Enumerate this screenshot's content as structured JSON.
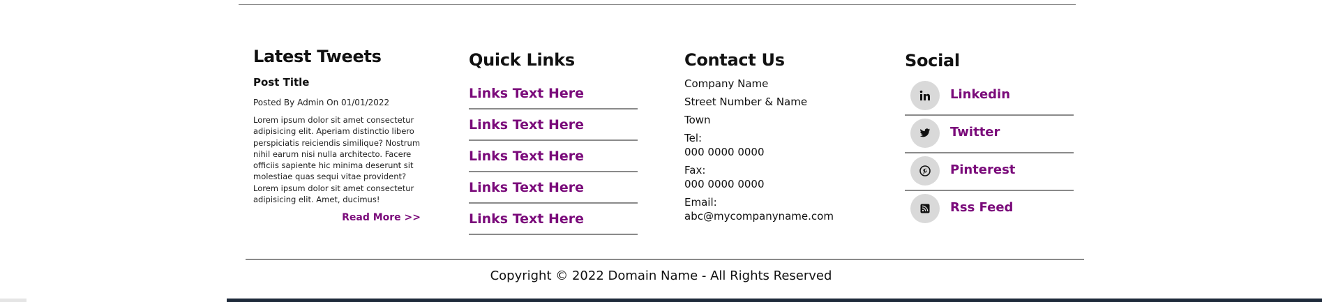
{
  "tweets": {
    "heading": "Latest Tweets",
    "post_title": "Post Title",
    "posted": "Posted By Admin On 01/01/2022",
    "body": "Lorem ipsum dolor sit amet consectetur adipisicing elit. Aperiam distinctio libero perspiciatis reiciendis similique? Nostrum nihil earum nisi nulla architecto. Facere officiis sapiente hic minima deserunt sit molestiae quas sequi vitae provident? Lorem ipsum dolor sit amet consectetur adipisicing elit. Amet, ducimus!",
    "read_more": "Read More >>"
  },
  "quick_links": {
    "heading": "Quick Links",
    "items": [
      {
        "label": "Links Text Here"
      },
      {
        "label": "Links Text Here"
      },
      {
        "label": "Links Text Here"
      },
      {
        "label": "Links Text Here"
      },
      {
        "label": "Links Text Here"
      }
    ]
  },
  "contact": {
    "heading": "Contact Us",
    "company": "Company Name",
    "street": "Street Number & Name",
    "town": "Town",
    "tel_label": "Tel:",
    "tel": "000 0000 0000",
    "fax_label": "Fax:",
    "fax": "000 0000 0000",
    "email_label": "Email:",
    "email": "abc@mycompanyname.com"
  },
  "social": {
    "heading": "Social",
    "items": [
      {
        "label": "Linkedin",
        "icon": "linkedin-icon"
      },
      {
        "label": "Twitter",
        "icon": "twitter-icon"
      },
      {
        "label": "Pinterest",
        "icon": "pinterest-icon"
      },
      {
        "label": "Rss Feed",
        "icon": "rss-icon"
      }
    ]
  },
  "footer": {
    "copyright": "Copyright © 2022 Domain Name - All Rights Reserved"
  },
  "colors": {
    "link": "#7a0a7a",
    "rule": "#8a8a8a",
    "icon_bg": "#d9d9d9"
  }
}
